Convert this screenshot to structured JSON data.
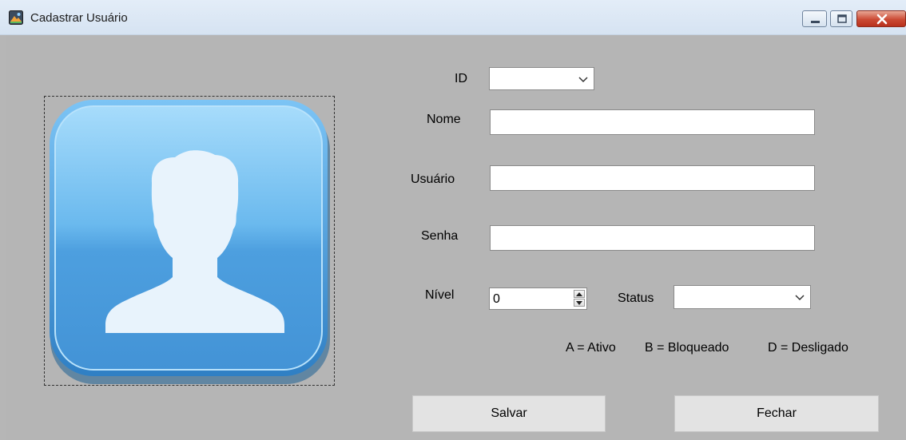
{
  "window": {
    "title": "Cadastrar Usuário",
    "icon": "app-icon",
    "controls": [
      "minimize-icon",
      "maximize-icon",
      "close-icon"
    ]
  },
  "form": {
    "id_label": "ID",
    "id_value": "",
    "nome_label": "Nome",
    "nome_value": "",
    "usuario_label": "Usuário",
    "usuario_value": "",
    "senha_label": "Senha",
    "senha_value": "",
    "nivel_label": "Nível",
    "nivel_value": "0",
    "status_label": "Status",
    "status_value": "",
    "legend": {
      "ativo": "A = Ativo",
      "bloqueado": "B = Bloqueado",
      "desligado": "D = Desligado"
    }
  },
  "photo": {
    "icon": "user-avatar-icon"
  },
  "buttons": {
    "save_label": "Salvar",
    "close_label": "Fechar"
  },
  "colors": {
    "client_background": "#b5b5b5",
    "avatar_blue": "#4aa3e6",
    "avatar_silhouette": "#e8f3fc",
    "close_button": "#c9432f"
  }
}
